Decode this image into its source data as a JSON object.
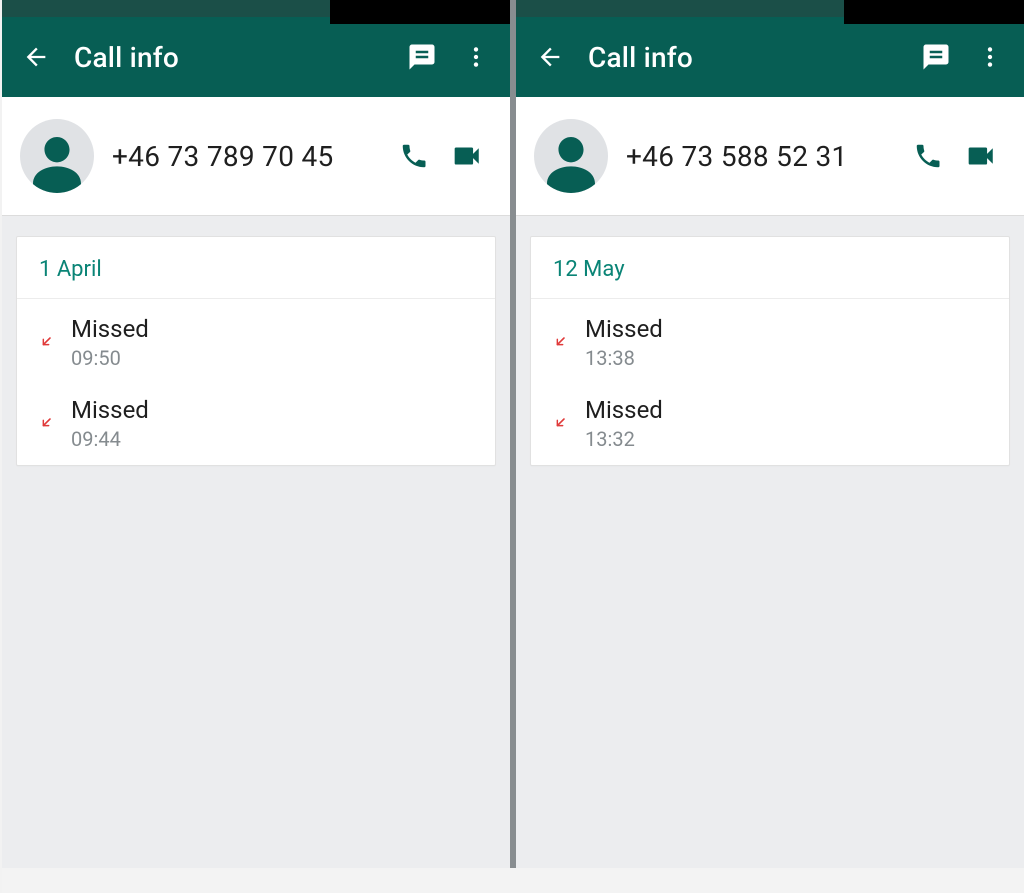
{
  "colors": {
    "teal_dark": "#075e54",
    "accent": "#0a8476",
    "missed_arrow": "#e03a3a"
  },
  "panes": [
    {
      "title": "Call info",
      "contact": {
        "phone": "+46 73 789 70 45"
      },
      "date_header": "1 April",
      "calls": [
        {
          "status": "Missed",
          "time": "09:50",
          "direction": "missed-incoming"
        },
        {
          "status": "Missed",
          "time": "09:44",
          "direction": "missed-incoming"
        }
      ]
    },
    {
      "title": "Call info",
      "contact": {
        "phone": "+46 73 588 52 31"
      },
      "date_header": "12 May",
      "calls": [
        {
          "status": "Missed",
          "time": "13:38",
          "direction": "missed-incoming"
        },
        {
          "status": "Missed",
          "time": "13:32",
          "direction": "missed-incoming"
        }
      ]
    }
  ]
}
